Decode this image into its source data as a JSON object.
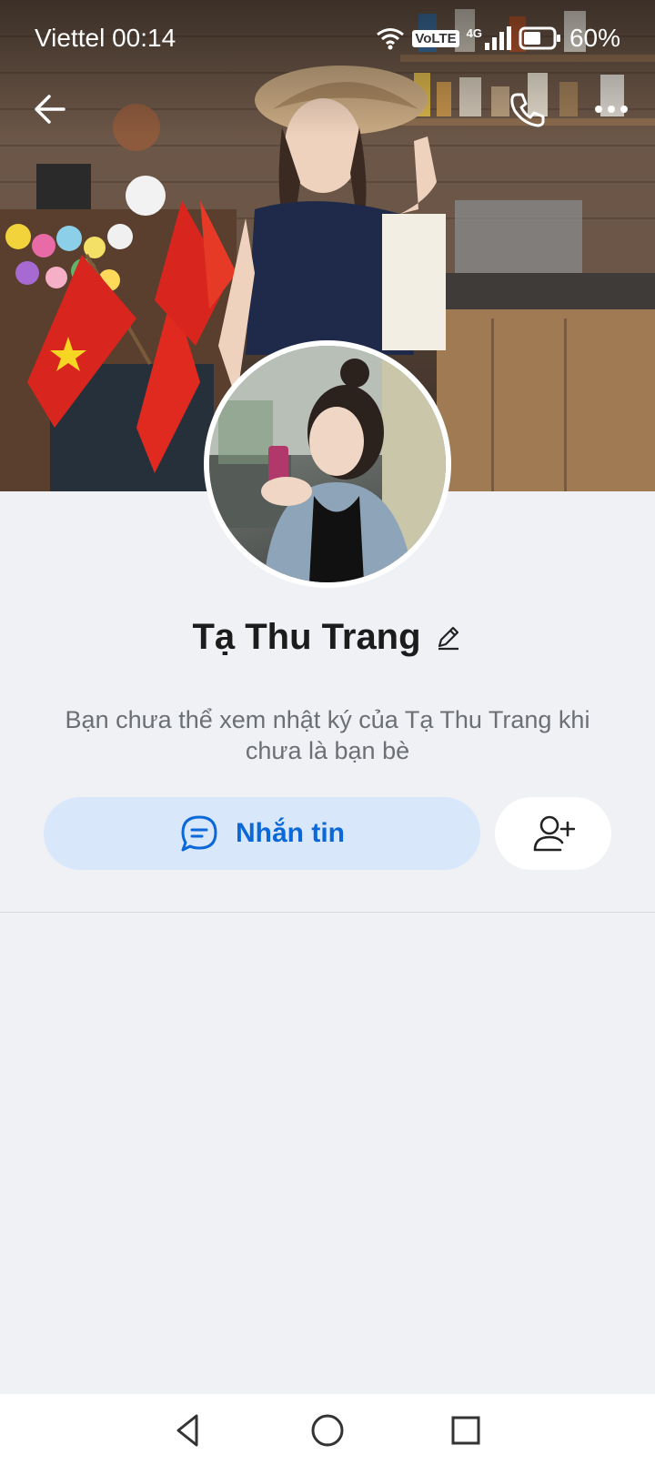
{
  "status_bar": {
    "carrier_time": "Viettel 00:14",
    "network_badge": "VoLTE",
    "network_type": "4G",
    "battery_percent": "60%",
    "battery_level": 0.6
  },
  "header": {
    "back_icon": "arrow-left-icon",
    "call_icon": "phone-icon",
    "more_icon": "more-horizontal-icon"
  },
  "profile": {
    "name": "Tạ Thu Trang",
    "edit_icon": "pencil-icon",
    "notice": "Bạn chưa thể xem nhật ký của Tạ Thu Trang khi chưa là bạn bè"
  },
  "actions": {
    "message_label": "Nhắn tin",
    "message_icon": "chat-bubble-icon",
    "add_friend_icon": "user-plus-icon"
  },
  "colors": {
    "accent": "#0a68d8",
    "accent_bg": "#d9e7fb",
    "page_bg": "#eff1f5"
  },
  "nav": {
    "back_icon": "triangle-back-icon",
    "home_icon": "circle-home-icon",
    "recents_icon": "square-recents-icon"
  }
}
